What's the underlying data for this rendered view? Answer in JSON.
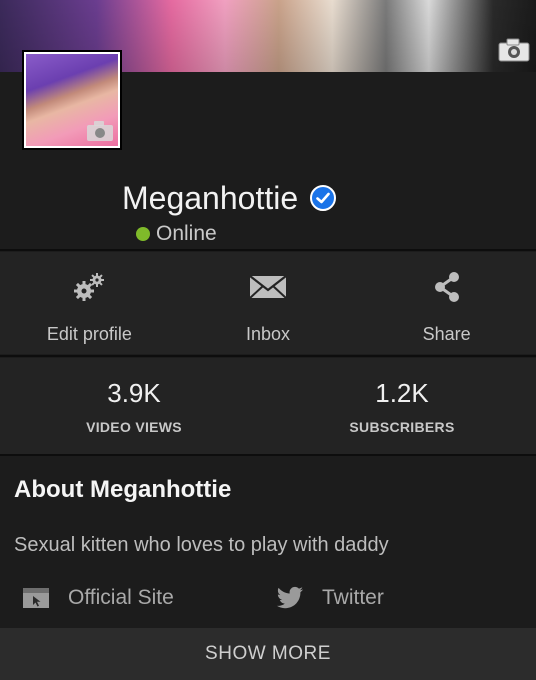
{
  "profile": {
    "name": "Meganhottie",
    "status": "Online",
    "verified_icon": "verified-badge-icon",
    "status_color": "#7fba2a"
  },
  "actions": [
    {
      "label": "Edit profile",
      "icon": "gears-icon"
    },
    {
      "label": "Inbox",
      "icon": "envelope-icon"
    },
    {
      "label": "Share",
      "icon": "share-icon"
    }
  ],
  "stats": [
    {
      "value": "3.9K",
      "label": "VIDEO VIEWS"
    },
    {
      "value": "1.2K",
      "label": "SUBSCRIBERS"
    }
  ],
  "about": {
    "title": "About Meganhottie",
    "bio": "Sexual kitten who loves to play with daddy",
    "links": [
      {
        "label": "Official Site",
        "icon": "website-icon"
      },
      {
        "label": "Twitter",
        "icon": "twitter-icon"
      }
    ]
  },
  "footer": {
    "show_more": "SHOW MORE"
  },
  "colors": {
    "accent_blue": "#1a73e8",
    "background": "#1c1c1c"
  }
}
